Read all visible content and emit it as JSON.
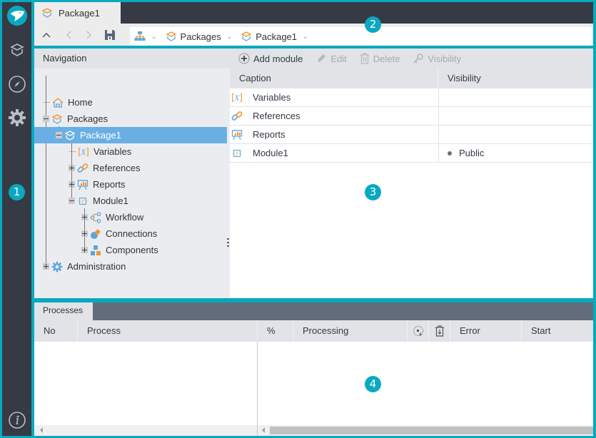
{
  "document_tab": {
    "label": "Package1",
    "icon": "package-icon"
  },
  "toolbar": {
    "up_icon": "chevron-up-icon",
    "back_icon": "chevron-left-icon",
    "forward_icon": "chevron-right-icon",
    "save_icon": "save-icon"
  },
  "breadcrumb": [
    {
      "label": "",
      "icon": "hierarchy-icon"
    },
    {
      "label": "Packages",
      "icon": "package-icon"
    },
    {
      "label": "Package1",
      "icon": "package-icon"
    }
  ],
  "rail": {
    "items": [
      {
        "name": "packages",
        "icon": "package-icon"
      },
      {
        "name": "navigate",
        "icon": "compass-icon"
      },
      {
        "name": "settings",
        "icon": "gear-icon"
      }
    ],
    "info_icon": "info-icon"
  },
  "badges": [
    "1",
    "2",
    "3",
    "4"
  ],
  "navigation": {
    "title": "Navigation",
    "tree": [
      {
        "label": "Home",
        "icon": "home-icon",
        "level": 0,
        "expander": "none"
      },
      {
        "label": "Packages",
        "icon": "package-icon",
        "level": 0,
        "expander": "minus"
      },
      {
        "label": "Package1",
        "icon": "package-icon",
        "level": 1,
        "expander": "minus",
        "selected": true
      },
      {
        "label": "Variables",
        "icon": "variables-icon",
        "level": 2,
        "expander": "none"
      },
      {
        "label": "References",
        "icon": "link-icon",
        "level": 2,
        "expander": "plus"
      },
      {
        "label": "Reports",
        "icon": "report-icon",
        "level": 2,
        "expander": "plus"
      },
      {
        "label": "Module1",
        "icon": "module-icon",
        "level": 2,
        "expander": "minus"
      },
      {
        "label": "Workflow",
        "icon": "workflow-icon",
        "level": 3,
        "expander": "plus"
      },
      {
        "label": "Connections",
        "icon": "connections-icon",
        "level": 3,
        "expander": "plus"
      },
      {
        "label": "Components",
        "icon": "components-icon",
        "level": 3,
        "expander": "plus"
      },
      {
        "label": "Administration",
        "icon": "gear-icon",
        "level": 0,
        "expander": "plus"
      }
    ]
  },
  "main": {
    "actions": [
      {
        "label": "Add module",
        "icon": "add-circle-icon",
        "enabled": true
      },
      {
        "label": "Edit",
        "icon": "pencil-icon",
        "enabled": false
      },
      {
        "label": "Delete",
        "icon": "trash-icon",
        "enabled": false
      },
      {
        "label": "Visibility",
        "icon": "key-icon",
        "enabled": false
      }
    ],
    "columns": [
      "Caption",
      "Visibility"
    ],
    "rows": [
      {
        "caption": "Variables",
        "icon": "variables-icon",
        "visibility": ""
      },
      {
        "caption": "References",
        "icon": "link-icon",
        "visibility": ""
      },
      {
        "caption": "Reports",
        "icon": "report-icon",
        "visibility": ""
      },
      {
        "caption": "Module1",
        "icon": "module-icon",
        "visibility": "Public"
      }
    ]
  },
  "processes": {
    "tab_label": "Processes",
    "columns": [
      "No",
      "Process",
      "%",
      "Processing",
      "",
      "",
      "Error",
      "Start"
    ],
    "column_icons": [
      "",
      "",
      "",
      "",
      "stop-process-icon",
      "clear-icon",
      "",
      ""
    ],
    "rows": []
  },
  "colors": {
    "frame": "#07a9bf",
    "rail": "#363a44",
    "selection": "#6aafe3",
    "accent_orange": "#f0962e",
    "accent_blue": "#5aa5de"
  }
}
